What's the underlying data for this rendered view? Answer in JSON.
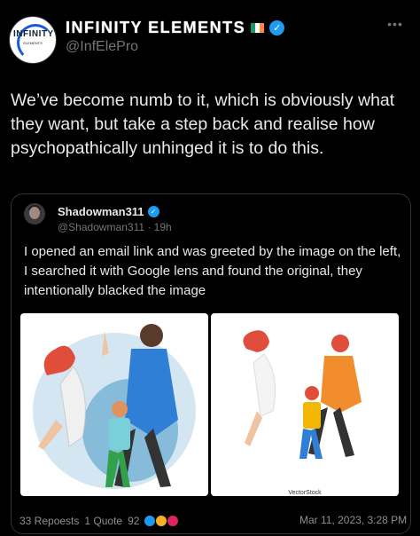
{
  "tweet": {
    "display_name": "INFINITY ELEMENTS",
    "handle": "@InfElePro",
    "avatar_text": "INFINITY",
    "avatar_sub": "ELEMENTS",
    "more_label": "•••",
    "text": "We’ve become numb to it, which is obviously what they want, but take a step back and realise how psychopathically unhinged it is to do this."
  },
  "quoted": {
    "display_name": "Shadowman311",
    "handle_meta": "@Shadowman311 · 19h",
    "text": "I opened an email link and was greeted by the image on the left, I searched it with Google lens and found the original, they intentionally blacked the image",
    "watermark": "VectorStock"
  },
  "stats": {
    "reposts": "33 Repoests",
    "quotes": "1 Quote",
    "reactions": "92",
    "timestamp": "Mar 11, 2023, 3:28 PM"
  },
  "colors": {
    "verified": "#1d9bf0",
    "flag": [
      "#169b62",
      "#ffffff",
      "#ff883e"
    ],
    "muted": "#71767b",
    "text": "#e7e9ea"
  },
  "icons": [
    "verified-icon",
    "ireland-flag-icon",
    "more-icon",
    "thumbs-up-icon",
    "sad-face-icon",
    "angry-face-icon"
  ]
}
